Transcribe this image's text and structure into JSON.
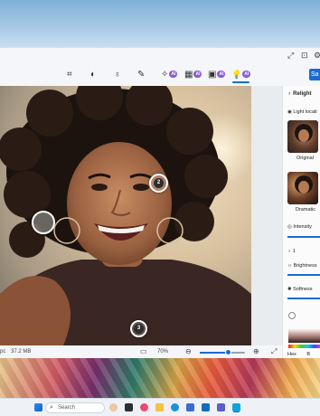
{
  "toolbar": {
    "tools": [
      {
        "name": "crop",
        "glyph": "⌗",
        "ai": false
      },
      {
        "name": "adjust",
        "glyph": "◐",
        "ai": false
      },
      {
        "name": "filter",
        "glyph": "♁",
        "ai": false
      },
      {
        "name": "markup",
        "glyph": "✎",
        "ai": false
      },
      {
        "name": "erase",
        "glyph": "✧",
        "ai": true
      },
      {
        "name": "background",
        "glyph": "▦",
        "ai": true
      },
      {
        "name": "style",
        "glyph": "▣",
        "ai": true
      },
      {
        "name": "relight",
        "glyph": "💡",
        "ai": true
      }
    ],
    "ai_badge": "AI",
    "save_label": "Sa"
  },
  "canvas": {
    "pins": [
      {
        "id": "1",
        "label": "1"
      },
      {
        "id": "2",
        "label": "2"
      },
      {
        "id": "3",
        "label": "3"
      }
    ]
  },
  "status": {
    "size_text": "37.2 MB",
    "left_text": "pc",
    "zoom_text": "70%",
    "zoom_level": 0.62
  },
  "panel": {
    "relight_title": "Relight",
    "light_location_label": "Light locati",
    "preset_original_label": "Original",
    "preset_dramatic_label": "Dramatic",
    "intensity_label": "Intensity",
    "light_selector_value": "1",
    "brightness_label": "Brightness",
    "softness_label": "Softness",
    "hex_label": "Hex",
    "hex_value": "B"
  },
  "taskbar": {
    "search_placeholder": "Search"
  },
  "colors": {
    "accent": "#1a6bd1",
    "ai_badge": "#8a5cd6"
  }
}
